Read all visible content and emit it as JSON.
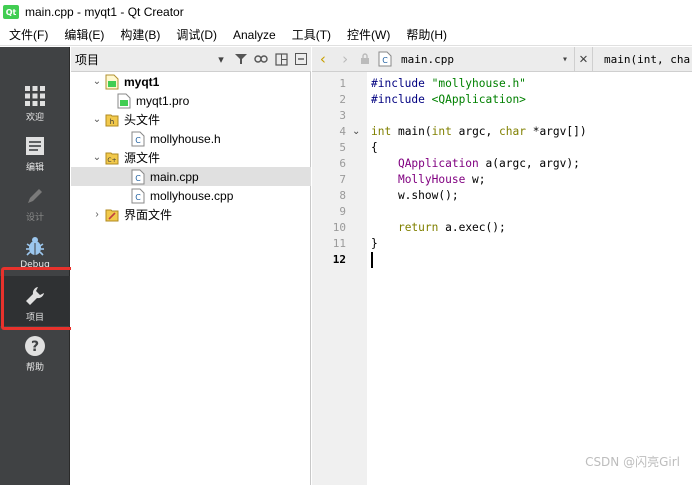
{
  "window": {
    "title": "main.cpp - myqt1 - Qt Creator",
    "app_icon_text": "Qt"
  },
  "menu": [
    "文件(F)",
    "编辑(E)",
    "构建(B)",
    "调试(D)",
    "Analyze",
    "工具(T)",
    "控件(W)",
    "帮助(H)"
  ],
  "modes": [
    {
      "label": "欢迎",
      "icon": "grid-icon",
      "enabled": true
    },
    {
      "label": "编辑",
      "icon": "document-icon",
      "enabled": true
    },
    {
      "label": "设计",
      "icon": "pencil-icon",
      "enabled": false
    },
    {
      "label": "Debug",
      "icon": "bug-icon",
      "enabled": true
    },
    {
      "label": "项目",
      "icon": "wrench-icon",
      "enabled": true
    },
    {
      "label": "帮助",
      "icon": "help-icon",
      "enabled": true
    }
  ],
  "project_pane": {
    "title": "项目",
    "tree": [
      {
        "label": "myqt1",
        "level": 0,
        "expand": "down",
        "icon": "project-icon",
        "bold": true
      },
      {
        "label": "myqt1.pro",
        "level": 1,
        "expand": "",
        "icon": "pro-file-icon"
      },
      {
        "label": "头文件",
        "level": 1,
        "expand": "down",
        "icon": "header-folder-icon"
      },
      {
        "label": "mollyhouse.h",
        "level": 2,
        "expand": "",
        "icon": "h-file-icon"
      },
      {
        "label": "源文件",
        "level": 1,
        "expand": "down",
        "icon": "source-folder-icon"
      },
      {
        "label": "main.cpp",
        "level": 2,
        "expand": "",
        "icon": "cpp-file-icon",
        "selected": true
      },
      {
        "label": "mollyhouse.cpp",
        "level": 2,
        "expand": "",
        "icon": "cpp-file-icon"
      },
      {
        "label": "界面文件",
        "level": 1,
        "expand": "right",
        "icon": "form-folder-icon"
      }
    ]
  },
  "editor": {
    "file": "main.cpp",
    "symbol": "main(int, char",
    "current_line": 12,
    "lines": [
      {
        "n": "1",
        "segs": [
          [
            "pp",
            "#include "
          ],
          [
            "str",
            "\"mollyhouse.h\""
          ]
        ]
      },
      {
        "n": "2",
        "segs": [
          [
            "pp",
            "#include "
          ],
          [
            "str",
            "<QApplication>"
          ]
        ]
      },
      {
        "n": "3",
        "segs": []
      },
      {
        "n": "4",
        "fold": true,
        "segs": [
          [
            "kw",
            "int"
          ],
          [
            "",
            " main("
          ],
          [
            "kw",
            "int"
          ],
          [
            "",
            " argc, "
          ],
          [
            "kw",
            "char"
          ],
          [
            "",
            " *argv[])"
          ]
        ]
      },
      {
        "n": "5",
        "segs": [
          [
            "",
            "{"
          ]
        ]
      },
      {
        "n": "6",
        "segs": [
          [
            "",
            "    "
          ],
          [
            "cls",
            "QApplication"
          ],
          [
            "",
            " a(argc, argv);"
          ]
        ]
      },
      {
        "n": "7",
        "segs": [
          [
            "",
            "    "
          ],
          [
            "cls",
            "MollyHouse"
          ],
          [
            "",
            " w;"
          ]
        ]
      },
      {
        "n": "8",
        "segs": [
          [
            "",
            "    w.show();"
          ]
        ]
      },
      {
        "n": "9",
        "segs": []
      },
      {
        "n": "10",
        "segs": [
          [
            "",
            "    "
          ],
          [
            "kw",
            "return"
          ],
          [
            "",
            " a.exec();"
          ]
        ]
      },
      {
        "n": "11",
        "segs": [
          [
            "",
            "}"
          ]
        ]
      },
      {
        "n": "12",
        "segs": []
      }
    ]
  },
  "watermark": "CSDN @闪亮Girl",
  "colors": {
    "modebar": "#404244",
    "highlight": "#e8322c",
    "keyword": "#808000",
    "preprocessor": "#000080",
    "string": "#008000",
    "class": "#800080"
  }
}
